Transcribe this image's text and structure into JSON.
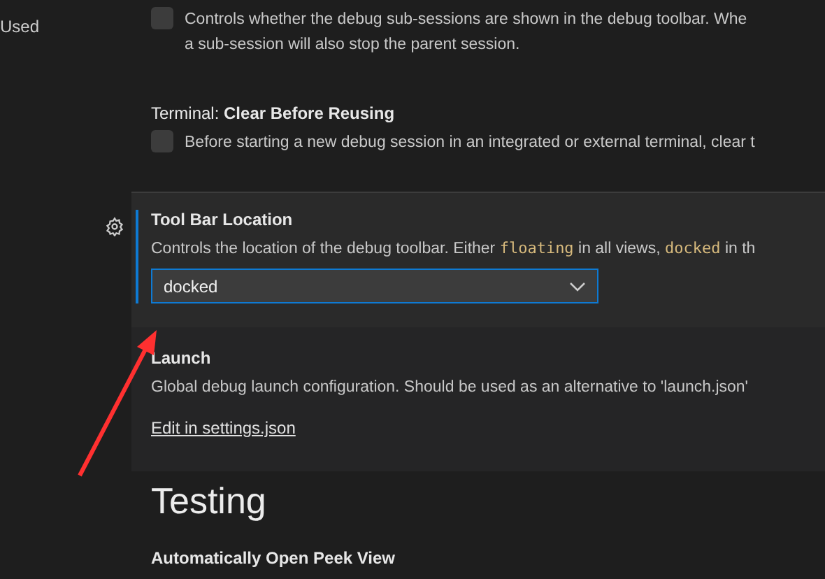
{
  "sidebar": {
    "items": [
      {
        "label": "Used"
      }
    ]
  },
  "settings": [
    {
      "kind": "checkbox",
      "checked": false,
      "description_lines": [
        "Controls whether the debug sub-sessions are shown in the debug toolbar. Whe",
        "a sub-session will also stop the parent session."
      ],
      "focused": false,
      "shaded": false
    },
    {
      "kind": "checkbox",
      "title_prefix": "Terminal: ",
      "title": "Clear Before Reusing",
      "checked": false,
      "description_lines": [
        "Before starting a new debug session in an integrated or external terminal, clear t"
      ],
      "focused": false,
      "shaded": false
    },
    {
      "kind": "dropdown",
      "title": "Tool Bar Location",
      "description_parts": [
        {
          "kind": "text",
          "text": "Controls the location of the debug toolbar. Either "
        },
        {
          "kind": "code",
          "text": "floating"
        },
        {
          "kind": "text",
          "text": " in all views, "
        },
        {
          "kind": "code",
          "text": "docked"
        },
        {
          "kind": "text",
          "text": " in th"
        }
      ],
      "value": "docked",
      "focused": true,
      "shaded": false
    },
    {
      "kind": "link",
      "title": "Launch",
      "description_lines": [
        "Global debug launch configuration. Should be used as an alternative to 'launch.json'"
      ],
      "link": "Edit in settings.json",
      "focused": false,
      "shaded": true
    }
  ],
  "section": {
    "heading": "Testing",
    "next_title": "Automatically Open Peek View"
  }
}
